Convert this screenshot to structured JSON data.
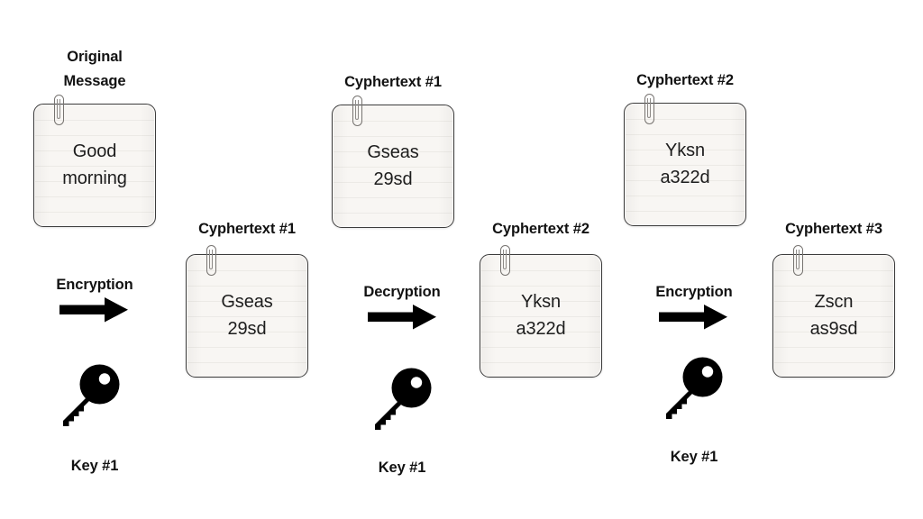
{
  "diagram": {
    "title_semantic": "symmetric-encryption-decryption-flow",
    "background_color": "#ffffff",
    "note_fill_color": "#faf8f6",
    "note_border_color": "#3c3c3c",
    "label_color": "#121212",
    "icon_color": "#000000"
  },
  "notes": [
    {
      "id": "original-message",
      "caption": "Original\nMessage",
      "content": "Good\nmorning"
    },
    {
      "id": "cyphertext-1-top",
      "caption": "Cyphertext #1",
      "content": "Gseas\n29sd"
    },
    {
      "id": "cyphertext-2-top",
      "caption": "Cyphertext #2",
      "content": "Yksn\na322d"
    },
    {
      "id": "cyphertext-1-mid",
      "caption": "Cyphertext #1",
      "content": "Gseas\n29sd"
    },
    {
      "id": "cyphertext-2-mid",
      "caption": "Cyphertext #2",
      "content": "Yksn\na322d"
    },
    {
      "id": "cyphertext-3-mid",
      "caption": "Cyphertext #3",
      "content": "Zscn\nas9sd"
    }
  ],
  "operations": [
    {
      "id": "op-1",
      "label": "Encryption",
      "arrow_icon": "right-arrow-icon",
      "key_icon": "key-icon",
      "key_label": "Key #1"
    },
    {
      "id": "op-2",
      "label": "Decryption",
      "arrow_icon": "right-arrow-icon",
      "key_icon": "key-icon",
      "key_label": "Key #1"
    },
    {
      "id": "op-3",
      "label": "Encryption",
      "arrow_icon": "right-arrow-icon",
      "key_icon": "key-icon",
      "key_label": "Key #1"
    }
  ]
}
